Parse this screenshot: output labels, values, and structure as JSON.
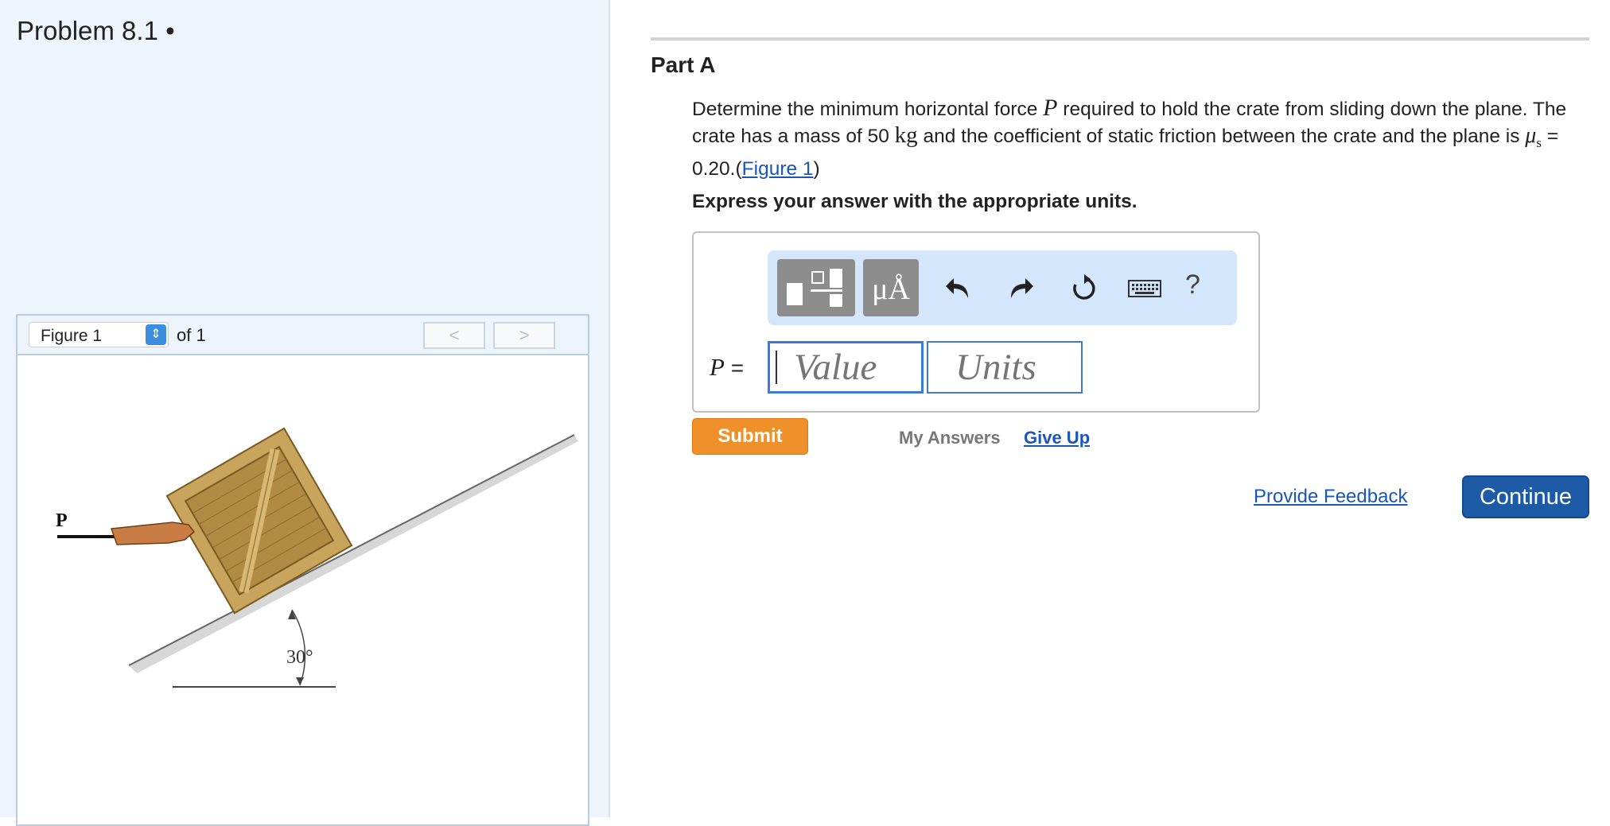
{
  "problem": {
    "title": "Problem 8.1 •"
  },
  "figure_panel": {
    "select_value": "Figure 1",
    "of_text": "of 1",
    "prev_label": "<",
    "next_label": ">",
    "force_label": "P",
    "angle_label": "30°"
  },
  "part": {
    "title": "Part A",
    "question_1": "Determine the minimum horizontal force ",
    "question_var": "P",
    "question_2": " required to hold the crate from sliding down the plane. The crate has a mass of 50 ",
    "question_unit": "kg",
    "question_3": " and the coefficient of static friction between the crate and the plane is ",
    "question_mu": "μ",
    "question_mu_sub": "s",
    "question_4": " = 0.20.(",
    "figure_link": "Figure 1",
    "question_5": ")",
    "instruction": "Express your answer with the appropriate units."
  },
  "answer": {
    "toolbar_units_label": "μÅ",
    "help_label": "?",
    "var_label": "P",
    "equals": " =",
    "value_placeholder": "Value",
    "units_placeholder": "Units"
  },
  "actions": {
    "submit": "Submit",
    "my_answers": "My Answers",
    "give_up": "Give Up",
    "provide_feedback": "Provide Feedback",
    "continue": "Continue"
  },
  "colors": {
    "accent_orange": "#f0902a",
    "accent_blue": "#1e5ba7",
    "link_blue": "#1a56b8",
    "toolbar_bg": "#d3e6fb"
  }
}
